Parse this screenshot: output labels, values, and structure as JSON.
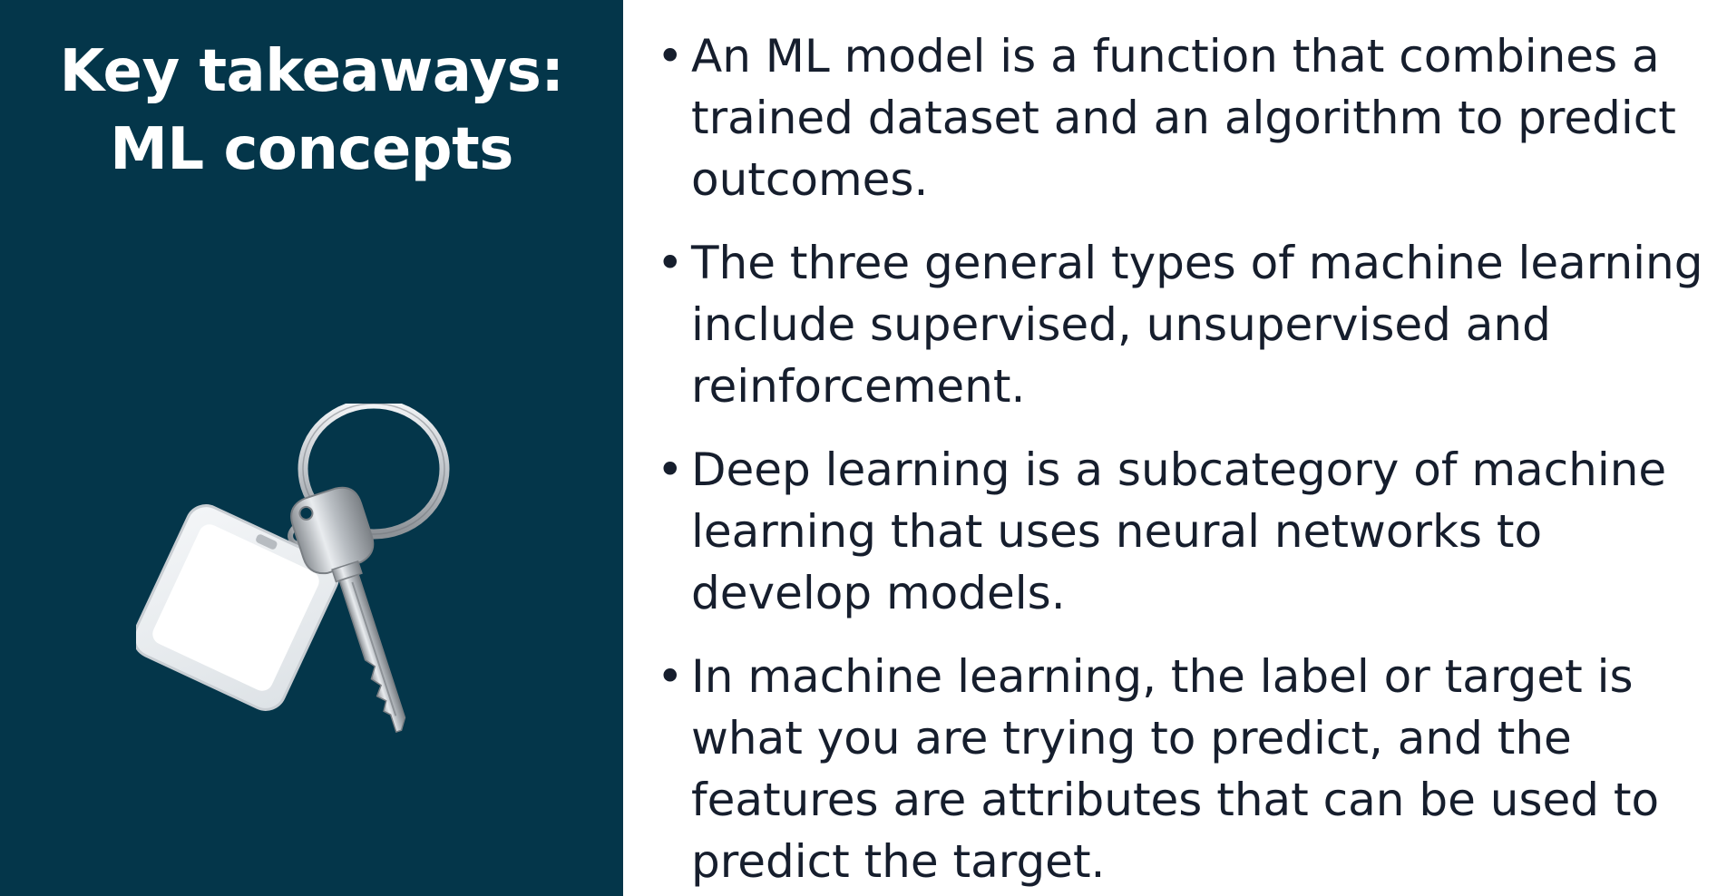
{
  "title": {
    "line1": "Key takeaways:",
    "line2": "ML concepts"
  },
  "image": {
    "icon": "keychain-icon"
  },
  "colors": {
    "left_panel_bg": "#04364a",
    "title_text": "#ffffff",
    "body_text": "#161e2d",
    "right_panel_bg": "#ffffff"
  },
  "bullets": [
    {
      "text": "An ML model is a function that combines a trained dataset and an algorithm to predict outcomes."
    },
    {
      "text": "The three general types of machine learning include supervised, unsupervised and reinforcement."
    },
    {
      "text": "Deep learning is a subcategory of machine learning that uses neural networks to develop models."
    },
    {
      "text": "In machine learning, the label or target is what you are trying to predict, and the features are attributes that can be used to predict the target."
    }
  ],
  "bullet_glyph": "•"
}
